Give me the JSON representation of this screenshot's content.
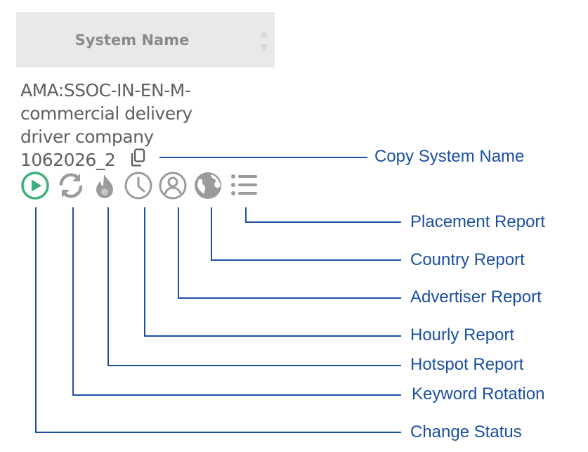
{
  "table": {
    "header": "System Name",
    "system_name_lines": [
      "AMA:SSOC-IN-EN-M-",
      "commercial delivery",
      "driver company",
      "1062026_2"
    ]
  },
  "icons": [
    {
      "name": "play-circle-icon",
      "color": "#3bb07a"
    },
    {
      "name": "refresh-icon",
      "color": "#9b9b9b"
    },
    {
      "name": "flame-icon",
      "color": "#9b9b9b"
    },
    {
      "name": "clock-icon",
      "color": "#9b9b9b"
    },
    {
      "name": "user-circle-icon",
      "color": "#9b9b9b"
    },
    {
      "name": "globe-icon",
      "color": "#9b9b9b"
    },
    {
      "name": "list-icon",
      "color": "#9b9b9b"
    }
  ],
  "callouts": {
    "copy_system_name": "Copy System Name",
    "placement_report": "Placement Report",
    "country_report": "Country Report",
    "advertiser_report": "Advertiser Report",
    "hourly_report": "Hourly Report",
    "hotspot_report": "Hotspot Report",
    "keyword_rotation": "Keyword Rotation",
    "change_status": "Change Status"
  },
  "colors": {
    "callout": "#1b4fa0",
    "header_bg": "#e9e9e9",
    "active": "#3bb07a",
    "icon_gray": "#9b9b9b"
  }
}
